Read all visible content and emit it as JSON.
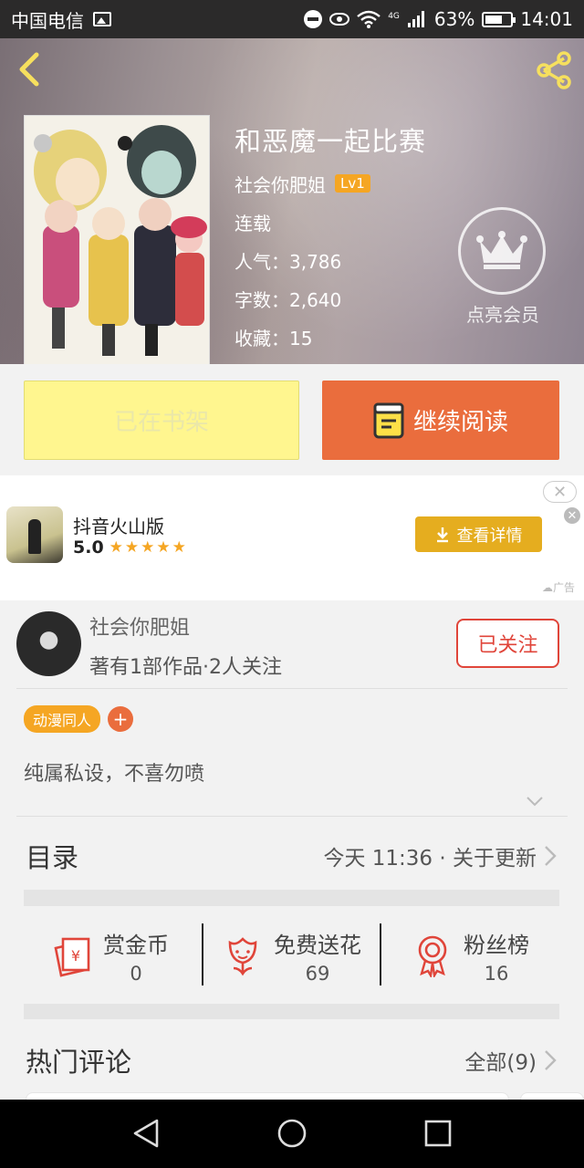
{
  "status_bar": {
    "carrier": "中国电信",
    "network": "4G",
    "battery": "63%",
    "time": "14:01"
  },
  "book": {
    "title": "和恶魔一起比赛",
    "author": "社会你肥姐",
    "level": "Lv1",
    "status": "连载",
    "popularity": "人气：3,786",
    "word_count": "字数：2,640",
    "favorites": "收藏：15"
  },
  "vip": {
    "label": "点亮会员"
  },
  "actions": {
    "shelf_label": "已在书架",
    "read_label": "继续阅读"
  },
  "ad": {
    "app_name": "抖音火山版",
    "rating": "5.0",
    "stars": "★★★★★",
    "button_label": "查看详情",
    "tag": "广告"
  },
  "author_card": {
    "name": "社会你肥姐",
    "meta": "著有1部作品·2人关注",
    "follow_label": "已关注"
  },
  "tags": [
    "动漫同人"
  ],
  "description": "纯属私设，不喜勿喷",
  "catalog": {
    "title": "目录",
    "update": "今天 11:36 · 关于更新"
  },
  "stats": [
    {
      "label": "赏金币",
      "value": "0",
      "icon": "reward-coin-icon"
    },
    {
      "label": "免费送花",
      "value": "69",
      "icon": "flower-icon"
    },
    {
      "label": "粉丝榜",
      "value": "16",
      "icon": "medal-icon"
    }
  ],
  "comments": {
    "title": "热门评论",
    "all_label": "全部(9)"
  },
  "colors": {
    "accent_orange": "#ea6d3d",
    "shelf_yellow": "#fff68f",
    "follow_red": "#e0453a",
    "tag_orange": "#f5a623",
    "ad_button": "#e5ad1f"
  }
}
